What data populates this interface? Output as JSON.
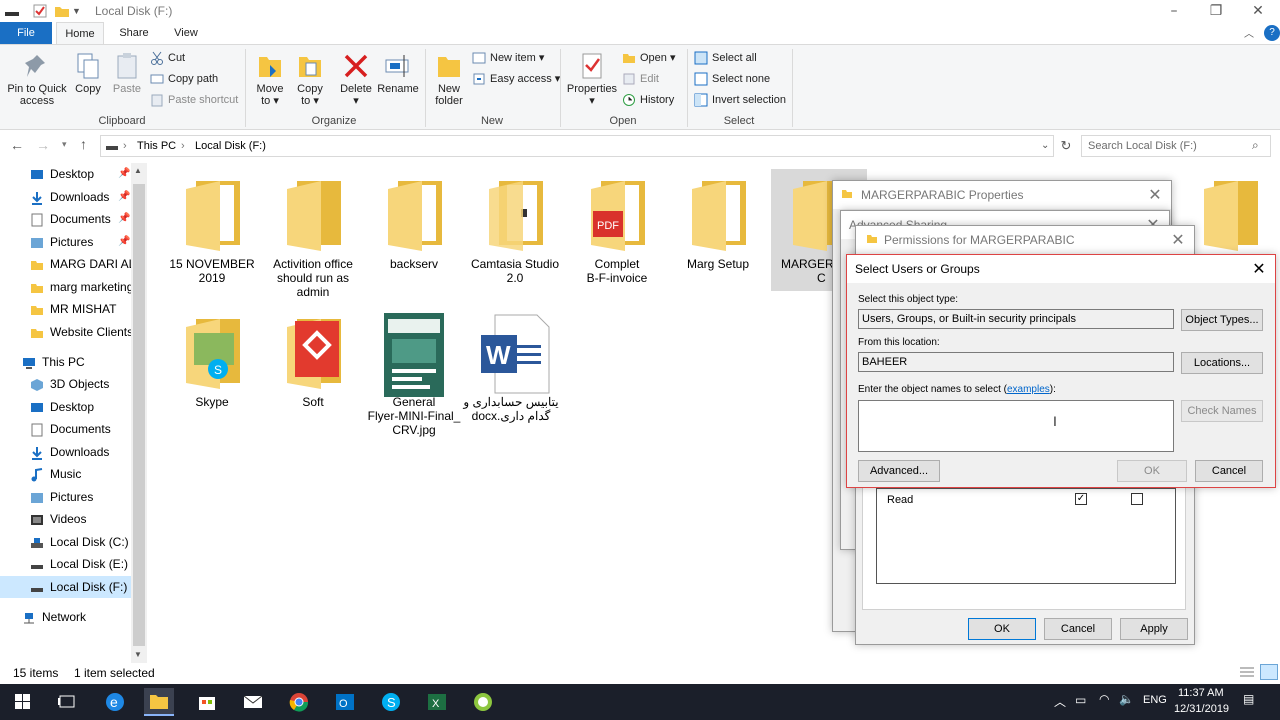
{
  "window": {
    "title": "Local Disk (F:)"
  },
  "tabs": {
    "file": "File",
    "home": "Home",
    "share": "Share",
    "view": "View"
  },
  "ribbon": {
    "pin": "Pin to Quick access",
    "copy": "Copy",
    "paste": "Paste",
    "cut": "Cut",
    "copy_path": "Copy path",
    "paste_shortcut": "Paste shortcut",
    "clipboard_group": "Clipboard",
    "move_to": "Move to",
    "copy_to": "Copy to",
    "delete": "Delete",
    "rename": "Rename",
    "organize_group": "Organize",
    "new_folder": "New folder",
    "new_item": "New item",
    "easy_access": "Easy access",
    "new_group": "New",
    "properties": "Properties",
    "open": "Open",
    "edit": "Edit",
    "history": "History",
    "open_group": "Open",
    "select_all": "Select all",
    "select_none": "Select none",
    "invert_selection": "Invert selection",
    "select_group": "Select"
  },
  "address": {
    "seg1": "This PC",
    "seg2": "Local Disk (F:)",
    "search_placeholder": "Search Local Disk (F:)"
  },
  "nav": {
    "quick": [
      "Desktop",
      "Downloads",
      "Documents",
      "Pictures",
      "MARG DARI ALL",
      "marg marketing",
      "MR MISHAT",
      "Website Clients I"
    ],
    "this_pc": "This PC",
    "pc_items": [
      "3D Objects",
      "Desktop",
      "Documents",
      "Downloads",
      "Music",
      "Pictures",
      "Videos",
      "Local Disk (C:)",
      "Local Disk (E:)",
      "Local Disk (F:)"
    ],
    "network": "Network"
  },
  "files": [
    {
      "line1": "15 NOVEMBER",
      "line2": "2019",
      "line3": ""
    },
    {
      "line1": "Activition office",
      "line2": "should run as",
      "line3": "admin"
    },
    {
      "line1": "backserv",
      "line2": "",
      "line3": ""
    },
    {
      "line1": "Camtasia Studio",
      "line2": "2.0",
      "line3": ""
    },
    {
      "line1": "Complet",
      "line2": "B-F-invoice",
      "line3": ""
    },
    {
      "line1": "Marg Setup",
      "line2": "",
      "line3": ""
    },
    {
      "line1": "MARGERPA",
      "line2": "C",
      "line3": ""
    },
    {
      "line1": "Skype",
      "line2": "",
      "line3": ""
    },
    {
      "line1": "Soft",
      "line2": "",
      "line3": ""
    },
    {
      "line1": "General",
      "line2": "Flyer-MINI-Final_",
      "line3": "CRV.jpg"
    },
    {
      "line1": "یتابیس حسابداری و",
      "line2": "گدام داری.docx",
      "line3": ""
    }
  ],
  "status": {
    "count": "15 items",
    "selected": "1 item selected"
  },
  "properties_dialog": {
    "title": "MARGERPARABIC Properties"
  },
  "advanced_sharing": {
    "title": "Advanced Sharing"
  },
  "permissions_dialog": {
    "title": "Permissions for MARGERPARABIC",
    "row_label": "Read",
    "ok": "OK",
    "cancel": "Cancel",
    "apply": "Apply"
  },
  "select_dialog": {
    "title": "Select Users or Groups",
    "object_type_label": "Select this object type:",
    "object_type_value": "Users, Groups, or Built-in security principals",
    "object_types_btn": "Object Types...",
    "location_label": "From this location:",
    "location_value": "BAHEER",
    "locations_btn": "Locations...",
    "names_label": "Enter the object names to select (",
    "examples_link": "examples",
    "names_label_end": "):",
    "check_names_btn": "Check Names",
    "advanced_btn": "Advanced...",
    "ok": "OK",
    "cancel": "Cancel"
  },
  "taskbar": {
    "time": "11:37 AM",
    "date": "12/31/2019",
    "lang": "ENG"
  }
}
